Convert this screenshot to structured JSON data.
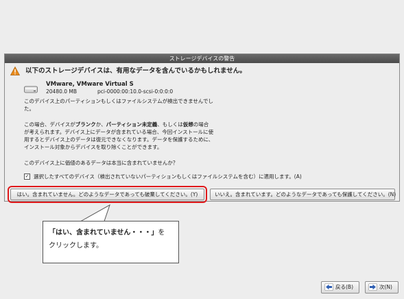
{
  "dialog": {
    "title": "ストレージデバイスの警告",
    "heading": "以下のストレージデバイスは、有用なデータを含んでいるかもしれません。",
    "device": {
      "name": "VMware, VMware Virtual S",
      "size": "20480.0 MB",
      "path": "pci-0000:00:10.0-scsi-0:0:0:0"
    },
    "paragraph1": {
      "line1": "このデバイス上のパーティションもしくはファイルシステムが検出できませんでし",
      "line2": "た。"
    },
    "paragraph2": {
      "line1_a": "この場合、デバイスが",
      "line1_b": "ブランク",
      "line1_c": "か、",
      "line1_d": "パーティション未定義",
      "line1_e": "、もしくは",
      "line1_f": "仮想",
      "line1_g": "の場合",
      "line2": "が考えられます。デバイス上にデータが含まれている場合、今回インストールに使",
      "line3": "用するとデバイス上のデータは復元できなくなります。データを保護するために、",
      "line4": "インストール対象からデバイスを取り除くことができます。"
    },
    "paragraph3": "このデバイス上に価値のあるデータは本当に含まれていませんか？",
    "checkbox_mark": "✓",
    "checkbox_label": "選択したすべてのデバイス（検出されていないパーティションもしくはファイルシステムを含む）に適用します。(A)",
    "yes_button": "はい。含まれていません。どのようなデータであっても破棄してください。(Y)",
    "no_button": "いいえ。含まれています。どのようなデータであっても保護してください。(N)"
  },
  "callout": {
    "line1_bold": "「はい、含まれていません・・・」",
    "line1_rest": "を",
    "line2": "クリックします。"
  },
  "nav": {
    "back_label": "戻る(B)",
    "next_label": "次(N)"
  },
  "colors": {
    "highlight_red": "#e0191b",
    "warning_orange": "#e8891a",
    "nav_arrow_blue": "#2f5fb3"
  }
}
